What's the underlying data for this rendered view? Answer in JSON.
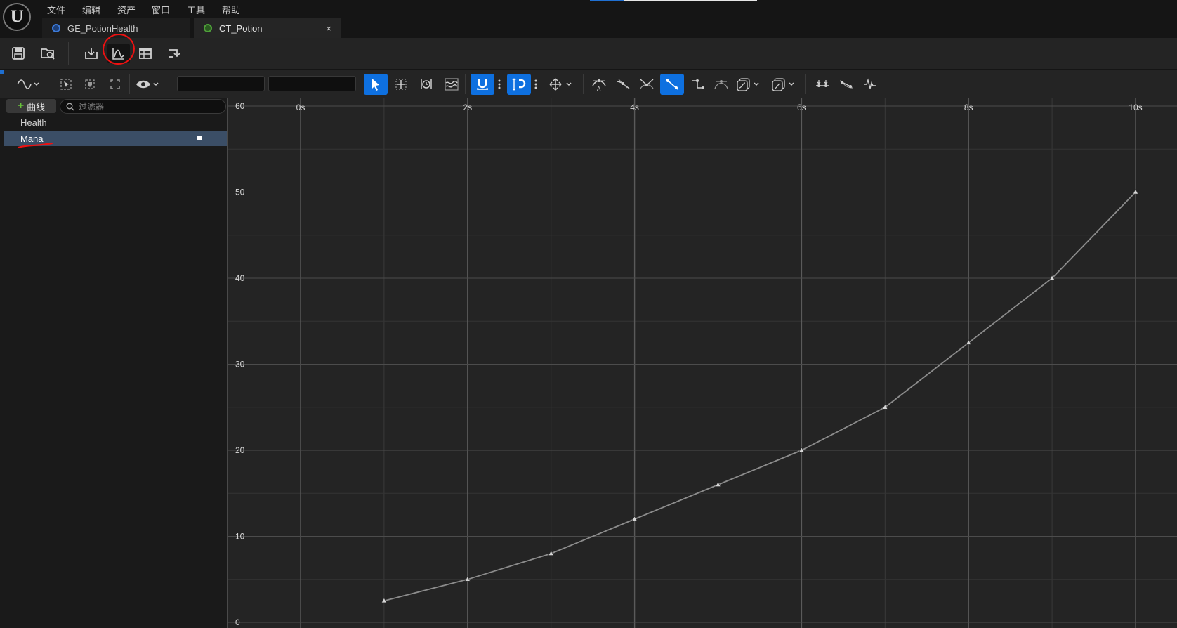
{
  "menu": [
    "文件",
    "编辑",
    "资产",
    "窗口",
    "工具",
    "帮助"
  ],
  "tabs": [
    {
      "label": "GE_PotionHealth",
      "icon": "gameplay-effect-icon"
    },
    {
      "label": "CT_Potion",
      "icon": "curve-table-icon",
      "close": "×"
    }
  ],
  "toolbar": {
    "buttons": [
      "save-icon",
      "browse-icon",
      "reimport-icon",
      "curve-view-icon",
      "table-view-icon",
      "key-options-icon"
    ],
    "active": "curve-view-icon"
  },
  "curve_toolbar": {
    "add_curve_label": "曲线",
    "filter_placeholder": "过滤器"
  },
  "curves": [
    {
      "label": "Health",
      "selected": false
    },
    {
      "label": "Mana",
      "selected": true
    }
  ],
  "annotation_color": "#ee1111",
  "chart_data": {
    "type": "line",
    "xlabel": "",
    "ylabel": "",
    "x_ticks": [
      "0s",
      "2s",
      "4s",
      "6s",
      "8s",
      "10s"
    ],
    "y_ticks": [
      "60",
      "50",
      "40",
      "30",
      "20",
      "10",
      "0"
    ],
    "xlim": [
      -0.8,
      10.5
    ],
    "ylim": [
      0,
      60
    ],
    "grid": true,
    "series": [
      {
        "name": "Mana",
        "x": [
          1,
          2,
          3,
          4,
          5,
          6,
          7,
          8,
          9,
          10
        ],
        "y": [
          2.5,
          5,
          8,
          12,
          16,
          20,
          25,
          32.5,
          40,
          50
        ]
      }
    ]
  }
}
